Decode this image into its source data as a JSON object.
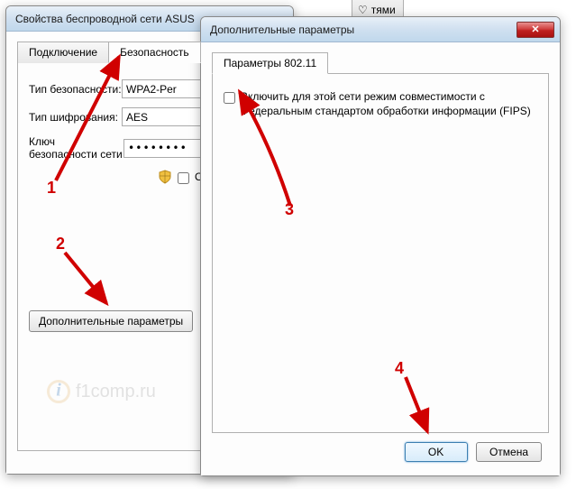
{
  "fragment_tab": {
    "heart": "♡",
    "label": "тями"
  },
  "window1": {
    "title": "Свойства беспроводной сети ASUS",
    "tabs": {
      "connection": "Подключение",
      "security": "Безопасность"
    },
    "fields": {
      "sec_type_label": "Тип безопасности:",
      "sec_type_value": "WPA2-Per",
      "enc_label": "Тип шифрования:",
      "enc_value": "AES",
      "key_label": "Ключ безопасности сети",
      "key_value": "••••••••",
      "show_checkbox": "Отобра"
    },
    "adv_button": "Дополнительные параметры",
    "watermark": "f1comp.ru"
  },
  "window2": {
    "title": "Дополнительные параметры",
    "close": "✕",
    "tab": "Параметры 802.11",
    "fips_checkbox": "Включить для этой сети режим совместимости с Федеральным стандартом обработки информации (FIPS)",
    "ok": "OK",
    "cancel": "Отмена"
  },
  "annotations": {
    "n1": "1",
    "n2": "2",
    "n3": "3",
    "n4": "4"
  }
}
